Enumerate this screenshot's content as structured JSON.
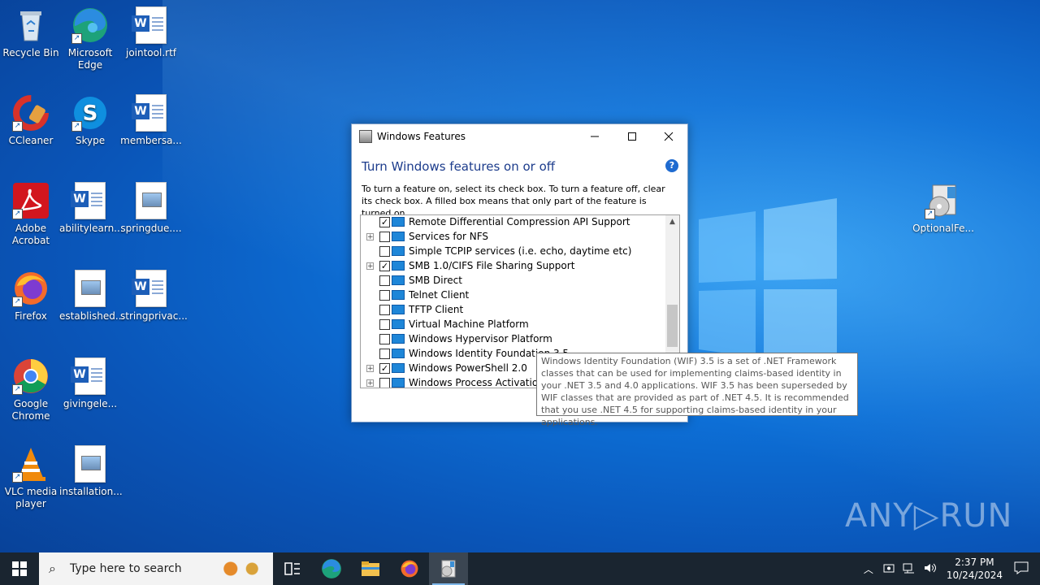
{
  "desktop": {
    "icons": [
      {
        "label": "Recycle Bin"
      },
      {
        "label": "Microsoft Edge"
      },
      {
        "label": "jointool.rtf"
      },
      {
        "label": "CCleaner"
      },
      {
        "label": "Skype"
      },
      {
        "label": "membersa..."
      },
      {
        "label": "Adobe Acrobat"
      },
      {
        "label": "abilitylearn..."
      },
      {
        "label": "springdue...."
      },
      {
        "label": "Firefox"
      },
      {
        "label": "established..."
      },
      {
        "label": "stringprivac..."
      },
      {
        "label": "Google Chrome"
      },
      {
        "label": "givingele..."
      },
      {
        "label": "VLC media player"
      },
      {
        "label": "installation..."
      },
      {
        "label": "OptionalFe..."
      }
    ]
  },
  "window": {
    "title": "Windows Features",
    "heading": "Turn Windows features on or off",
    "help_icon": "?",
    "description": "To turn a feature on, select its check box. To turn a feature off, clear its check box. A filled box means that only part of the feature is turned on.",
    "features": [
      {
        "label": "Remote Differential Compression API Support",
        "checked": "✓",
        "expander": ""
      },
      {
        "label": "Services for NFS",
        "checked": "",
        "expander": "+"
      },
      {
        "label": "Simple TCPIP services (i.e. echo, daytime etc)",
        "checked": "",
        "expander": ""
      },
      {
        "label": "SMB 1.0/CIFS File Sharing Support",
        "checked": "✓",
        "expander": "+"
      },
      {
        "label": "SMB Direct",
        "checked": "",
        "expander": ""
      },
      {
        "label": "Telnet Client",
        "checked": "",
        "expander": ""
      },
      {
        "label": "TFTP Client",
        "checked": "",
        "expander": ""
      },
      {
        "label": "Virtual Machine Platform",
        "checked": "",
        "expander": ""
      },
      {
        "label": "Windows Hypervisor Platform",
        "checked": "",
        "expander": ""
      },
      {
        "label": "Windows Identity Foundation 3.5",
        "checked": "",
        "expander": ""
      },
      {
        "label": "Windows PowerShell 2.0",
        "checked": "✓",
        "expander": "+"
      },
      {
        "label": "Windows Process Activation Service",
        "checked": "",
        "expander": "+"
      }
    ]
  },
  "tooltip": {
    "text": "Windows Identity Foundation (WIF) 3.5 is a set of .NET Framework classes that can be used for implementing claims-based identity in your .NET 3.5 and 4.0 applications. WIF 3.5 has been superseded by WIF classes that are provided as part of .NET 4.5. It is recommended that you use .NET 4.5 for supporting claims-based identity in your applications."
  },
  "watermark": "ANY▷RUN",
  "taskbar": {
    "search_placeholder": "Type here to search",
    "time": "2:37 PM",
    "date": "10/24/2024"
  },
  "colors": {
    "heading": "#1c3c8c",
    "taskbar": "#1a2530",
    "accent": "#1f6bd0"
  }
}
